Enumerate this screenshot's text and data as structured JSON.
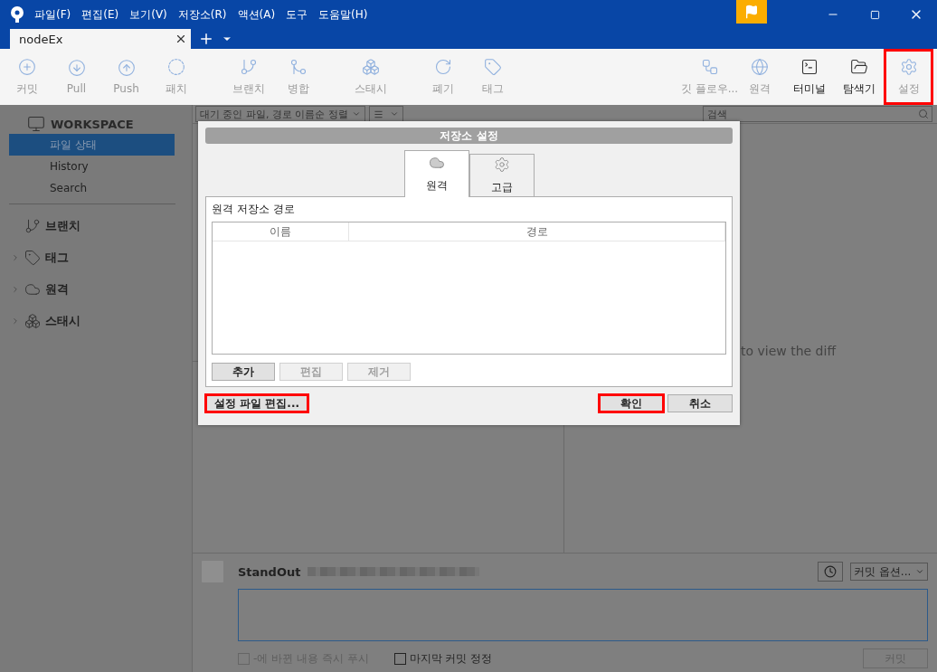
{
  "window": {
    "menus": [
      "파일(F)",
      "편집(E)",
      "보기(V)",
      "저장소(R)",
      "액션(A)",
      "도구",
      "도움말(H)"
    ]
  },
  "tabs": [
    {
      "label": "nodeEx",
      "selected": true
    }
  ],
  "toolbar": {
    "left": [
      {
        "label": "커밋",
        "kind": "action"
      },
      {
        "label": "Pull",
        "kind": "action"
      },
      {
        "label": "Push",
        "kind": "action"
      },
      {
        "label": "패치",
        "kind": "action"
      },
      {
        "label": "브랜치",
        "kind": "action"
      },
      {
        "label": "병합",
        "kind": "action"
      },
      {
        "label": "스태시",
        "kind": "action"
      },
      {
        "label": "폐기",
        "kind": "action"
      },
      {
        "label": "태그",
        "kind": "action"
      }
    ],
    "right": [
      {
        "label": "깃 플로우...",
        "kind": "action",
        "highlighted": false
      },
      {
        "label": "원격",
        "kind": "action",
        "highlighted": false
      },
      {
        "label": "터미널",
        "kind": "app",
        "highlighted": false
      },
      {
        "label": "탐색기",
        "kind": "app",
        "highlighted": false
      },
      {
        "label": "설정",
        "kind": "action",
        "highlighted": true
      }
    ]
  },
  "sidebar": {
    "workspace": "WORKSPACE",
    "items": [
      {
        "label": "파일 상태",
        "selected": true
      },
      {
        "label": "History",
        "selected": false
      },
      {
        "label": "Search",
        "selected": false
      }
    ],
    "sections": [
      {
        "label": "브랜치",
        "expandable": false
      },
      {
        "label": "태그",
        "expandable": true
      },
      {
        "label": "원격",
        "expandable": true
      },
      {
        "label": "스태시",
        "expandable": true
      }
    ]
  },
  "file_list": {
    "sort": "대기 중인 파일, 경로 이름순 정렬",
    "search": {
      "placeholder": "검색"
    }
  },
  "diff": {
    "hint": "to view the diff"
  },
  "commit": {
    "author": "StandOut",
    "options": "커밋 옵션...",
    "checkboxes": [
      {
        "label": "-에 바뀐 내용 즉시 푸시",
        "checked": false,
        "disabled": true
      },
      {
        "label": "마지막 커밋 정정",
        "checked": false,
        "disabled": false
      }
    ],
    "button": {
      "label": "커밋",
      "disabled": true
    }
  },
  "dialog": {
    "title": "저장소 설정",
    "tabs": [
      {
        "label": "원격",
        "selected": true
      },
      {
        "label": "고급",
        "selected": false
      }
    ],
    "section": "원격 저장소 경로",
    "columns": [
      "이름",
      "경로"
    ],
    "actions": [
      {
        "label": "추가",
        "disabled": false
      },
      {
        "label": "편집",
        "disabled": true
      },
      {
        "label": "제거",
        "disabled": true
      }
    ],
    "edit_config": {
      "label": "설정 파일 편집...",
      "highlighted": true
    },
    "buttons": [
      {
        "label": "확인",
        "highlighted": true
      },
      {
        "label": "취소",
        "highlighted": false
      }
    ]
  }
}
